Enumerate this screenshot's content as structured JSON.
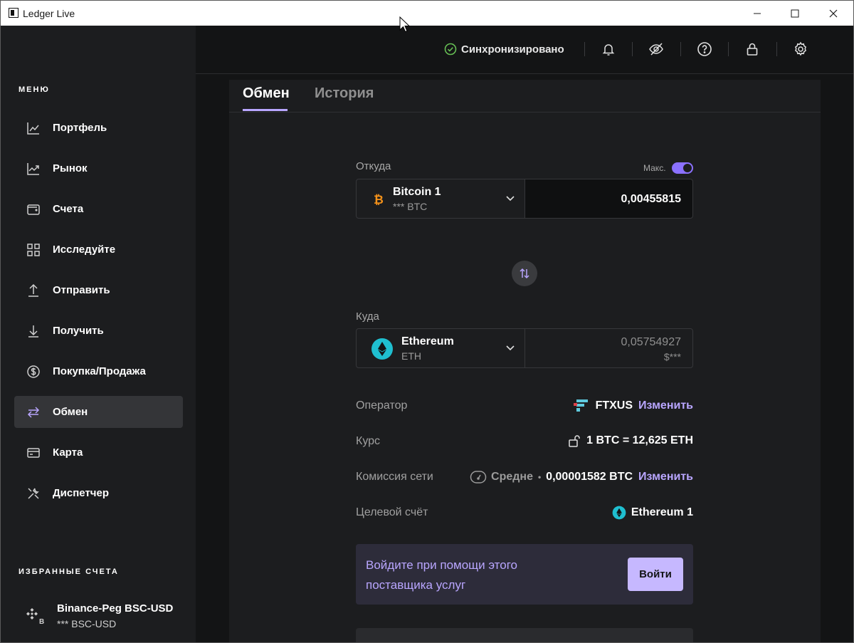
{
  "window": {
    "title": "Ledger Live"
  },
  "sidebar": {
    "menu_label": "МЕНЮ",
    "items": [
      {
        "label": "Портфель",
        "icon": "chart-line-icon"
      },
      {
        "label": "Рынок",
        "icon": "trending-icon"
      },
      {
        "label": "Счета",
        "icon": "wallet-icon"
      },
      {
        "label": "Исследуйте",
        "icon": "grid-icon"
      },
      {
        "label": "Отправить",
        "icon": "arrow-up-icon"
      },
      {
        "label": "Получить",
        "icon": "arrow-down-icon"
      },
      {
        "label": "Покупка/Продажа",
        "icon": "dollar-circle-icon"
      },
      {
        "label": "Обмен",
        "icon": "swap-arrows-icon",
        "active": true
      },
      {
        "label": "Карта",
        "icon": "card-icon"
      },
      {
        "label": "Диспетчер",
        "icon": "tools-icon"
      }
    ],
    "favorites_label": "ИЗБРАННЫЕ СЧЕТА",
    "favorites": [
      {
        "name": "Binance-Peg BSC-USD",
        "sub": "*** BSC-USD",
        "badge": "B"
      }
    ]
  },
  "topbar": {
    "sync_status": "Синхронизировано",
    "accent_color": "#b9a6ff",
    "success_color": "#66be54"
  },
  "tabs": [
    {
      "label": "Обмен"
    },
    {
      "label": "История"
    }
  ],
  "swap": {
    "from_label": "Откуда",
    "max_label": "Макс.",
    "max_enabled": true,
    "from_account": "Bitcoin 1",
    "from_sub": "*** BTC",
    "from_amount": "0,00455815",
    "to_label": "Куда",
    "to_account": "Ethereum",
    "to_sub": "ETH",
    "to_amount": "0,05754927",
    "to_fiat": "$***"
  },
  "details": {
    "provider_label": "Оператор",
    "provider_name": "FTXUS",
    "change_label": "Изменить",
    "rate_label": "Курс",
    "rate_value": "1 BTC = 12,625 ETH",
    "fee_label": "Комиссия сети",
    "fee_speed": "Средне",
    "fee_separator": "•",
    "fee_value": "0,00001582 BTC",
    "target_label": "Целевой счёт",
    "target_value": "Ethereum 1"
  },
  "login": {
    "text": "Войдите при помощи этого поставщика услуг",
    "button": "Войти"
  }
}
